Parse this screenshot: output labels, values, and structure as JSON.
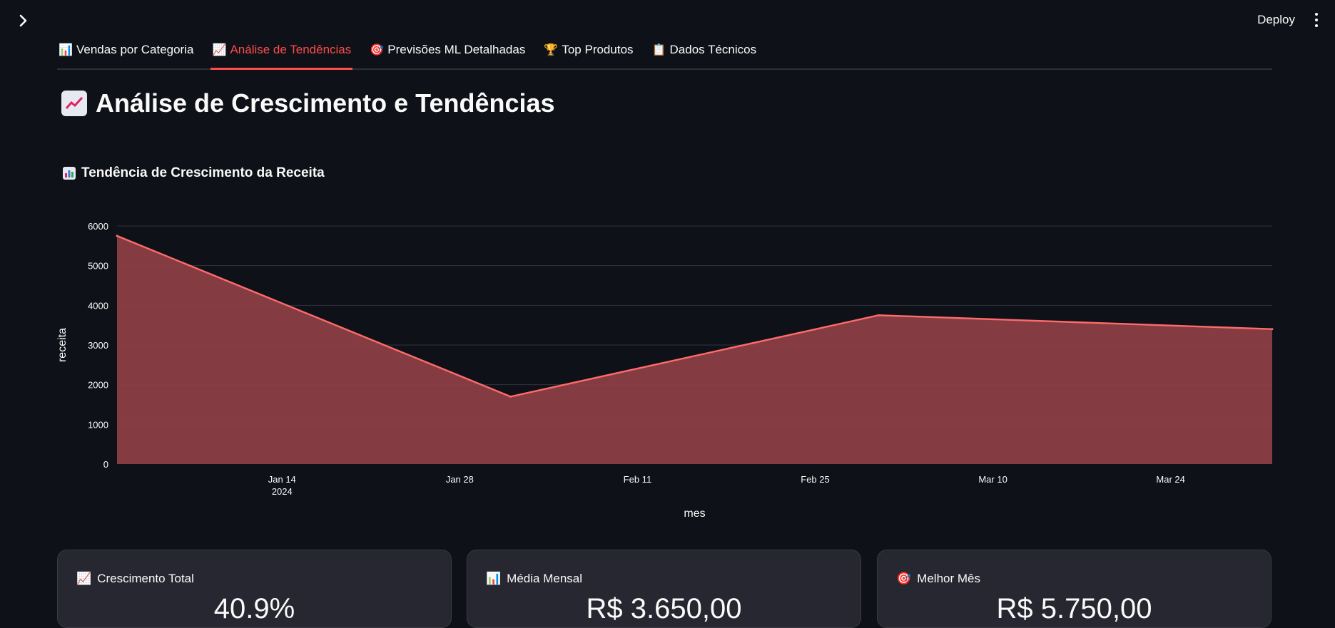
{
  "app": {
    "deploy_label": "Deploy"
  },
  "tabs": [
    {
      "label": "Vendas por Categoria",
      "icon": "bar-chart-icon",
      "active": false
    },
    {
      "label": "Análise de Tendências",
      "icon": "trending-up-icon",
      "active": true
    },
    {
      "label": "Previsões ML Detalhadas",
      "icon": "target-icon",
      "active": false
    },
    {
      "label": "Top Produtos",
      "icon": "trophy-icon",
      "active": false
    },
    {
      "label": "Dados Técnicos",
      "icon": "clipboard-icon",
      "active": false
    }
  ],
  "page": {
    "title": "Análise de Crescimento e Tendências"
  },
  "chart_section": {
    "title": "Tendência de Crescimento da Receita"
  },
  "chart_data": {
    "type": "area",
    "title": "",
    "xlabel": "mes",
    "ylabel": "receita",
    "x": [
      "2024-01-01",
      "2024-02-01",
      "2024-03-01",
      "2024-04-01"
    ],
    "series": [
      {
        "values": [
          5750,
          1700,
          3750,
          3400
        ]
      }
    ],
    "x_ticks": [
      "Jan 14",
      "Jan 28",
      "Feb 11",
      "Feb 25",
      "Mar 10",
      "Mar 24"
    ],
    "x_tick_sub": "2024",
    "y_ticks": [
      0,
      1000,
      2000,
      3000,
      4000,
      5000,
      6000
    ],
    "ylim": [
      0,
      6000
    ],
    "grid": true,
    "colors": {
      "line": "#ff6b6b",
      "fill": "#8c3e44",
      "grid": "#31333f"
    }
  },
  "metrics": [
    {
      "label": "Crescimento Total",
      "icon": "trending-up-icon",
      "value": "40.9%"
    },
    {
      "label": "Média Mensal",
      "icon": "bar-chart-icon",
      "value": "R$ 3.650,00"
    },
    {
      "label": "Melhor Mês",
      "icon": "target-icon",
      "value": "R$ 5.750,00"
    }
  ],
  "colors": {
    "accent": "#ff4b4b",
    "background": "#0e1117",
    "card": "#262730"
  }
}
